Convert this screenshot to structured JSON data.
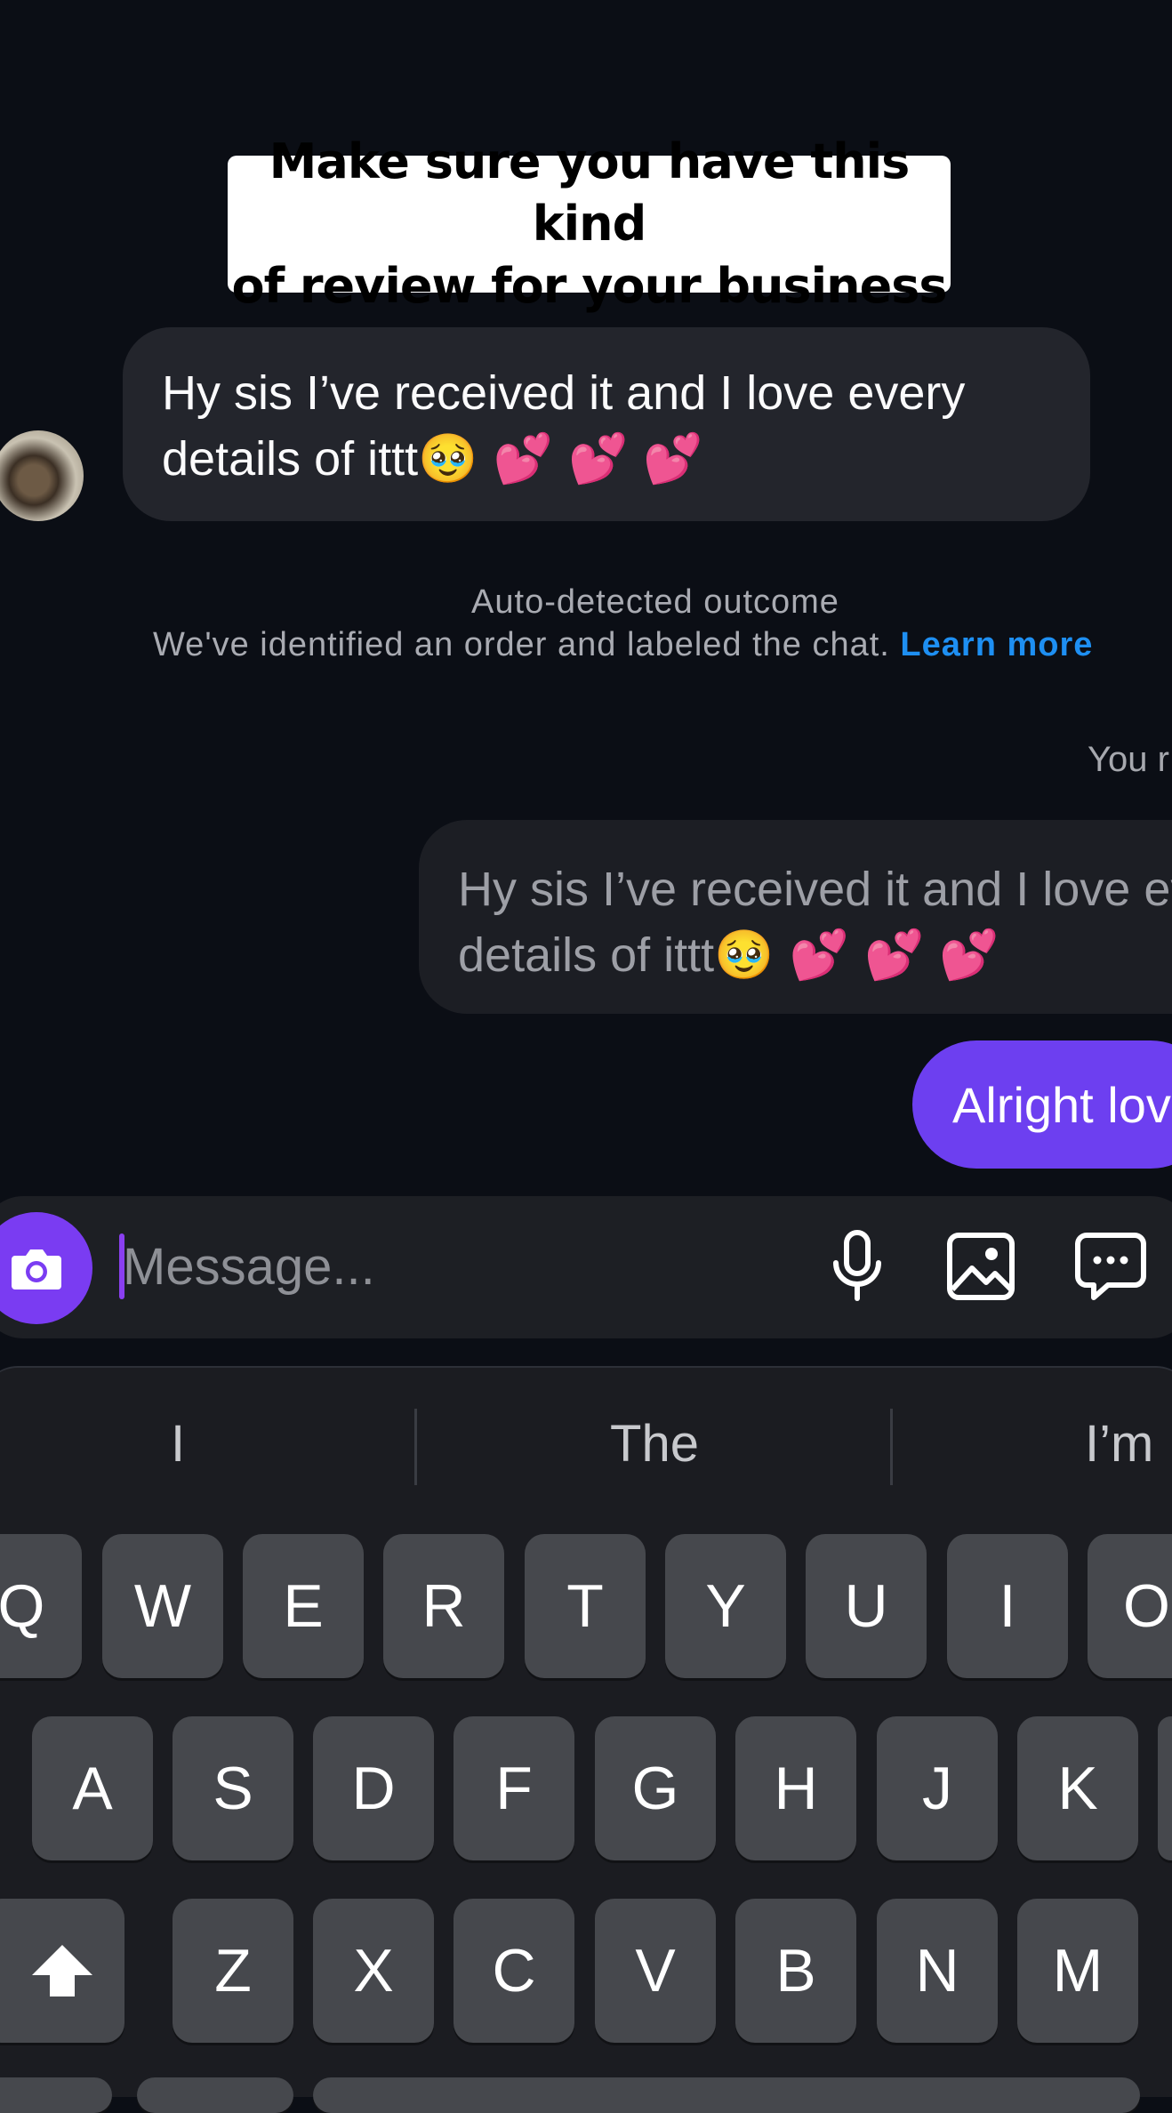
{
  "caption": {
    "line1": "Make sure you have this kind",
    "line2": "of review for your business"
  },
  "incoming_message": {
    "line1": "Hy sis I’ve received it and I love every",
    "line2": "details of ittt",
    "emojis": "🥹 💕 💕 💕"
  },
  "notice": {
    "title": "Auto-detected outcome",
    "body": "We've identified an order and labeled the chat.",
    "link": "Learn more"
  },
  "you_label": "You r",
  "quoted_message": {
    "line1": "Hy sis I’ve received it and I love ev",
    "line2": "details of ittt",
    "emojis": "🥹 💕 💕 💕"
  },
  "outgoing_message": "Alright lov",
  "composer": {
    "placeholder": "Message...",
    "icons": [
      "camera-icon",
      "microphone-icon",
      "image-icon",
      "sticker-chat-icon"
    ]
  },
  "keyboard": {
    "suggestions": [
      "I",
      "The",
      "I’m"
    ],
    "row1": [
      "Q",
      "W",
      "E",
      "R",
      "T",
      "Y",
      "U",
      "I",
      "O"
    ],
    "row2": [
      "A",
      "S",
      "D",
      "F",
      "G",
      "H",
      "J",
      "K"
    ],
    "row3": [
      "Z",
      "X",
      "C",
      "V",
      "B",
      "N",
      "M"
    ],
    "shift_icon": "shift-icon"
  },
  "colors": {
    "background": "#0b0e15",
    "incoming_bubble": "#23252c",
    "outgoing_bubble": "#6d3ff0",
    "link": "#1e8ff2",
    "camera_button": "#7a3cf2"
  }
}
